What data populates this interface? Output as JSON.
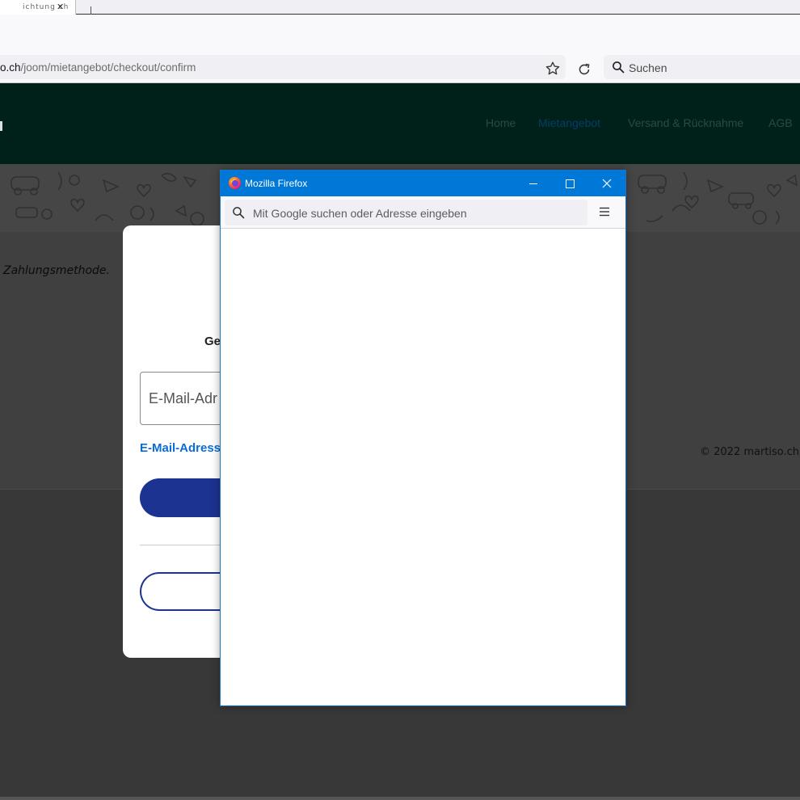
{
  "browser": {
    "tab": {
      "title": "ichtung ch",
      "close": "✕"
    },
    "url": {
      "host": "o.ch",
      "path": "/joom/mietangebot/checkout/confirm"
    },
    "search": {
      "placeholder": "Suchen"
    },
    "icons": [
      "star-icon",
      "reload-icon",
      "search-icon"
    ]
  },
  "site": {
    "nav": [
      {
        "label": "Home",
        "active": false
      },
      {
        "label": "Mietangebot",
        "active": true
      },
      {
        "label": "Versand & Rücknahme",
        "active": false
      },
      {
        "label": "AGB",
        "active": false
      }
    ],
    "main_text": "Zahlungsmethode.",
    "copyright": "© 2022 martiso.ch",
    "colors": {
      "header": "#00201a",
      "primary_button": "#1c3391",
      "link": "#0a6cd6"
    }
  },
  "login_card": {
    "heading": "Ge",
    "email_placeholder": "E-Mail-Adr",
    "email_link": "E-Mail-Adress"
  },
  "popup": {
    "title": "Mozilla Firefox",
    "url_placeholder": "Mit Google suchen oder Adresse eingeben",
    "titlebar_color": "#0078d7",
    "icons": [
      "firefox-logo-icon",
      "minimize-icon",
      "maximize-icon",
      "close-icon",
      "search-icon",
      "hamburger-menu-icon"
    ]
  }
}
